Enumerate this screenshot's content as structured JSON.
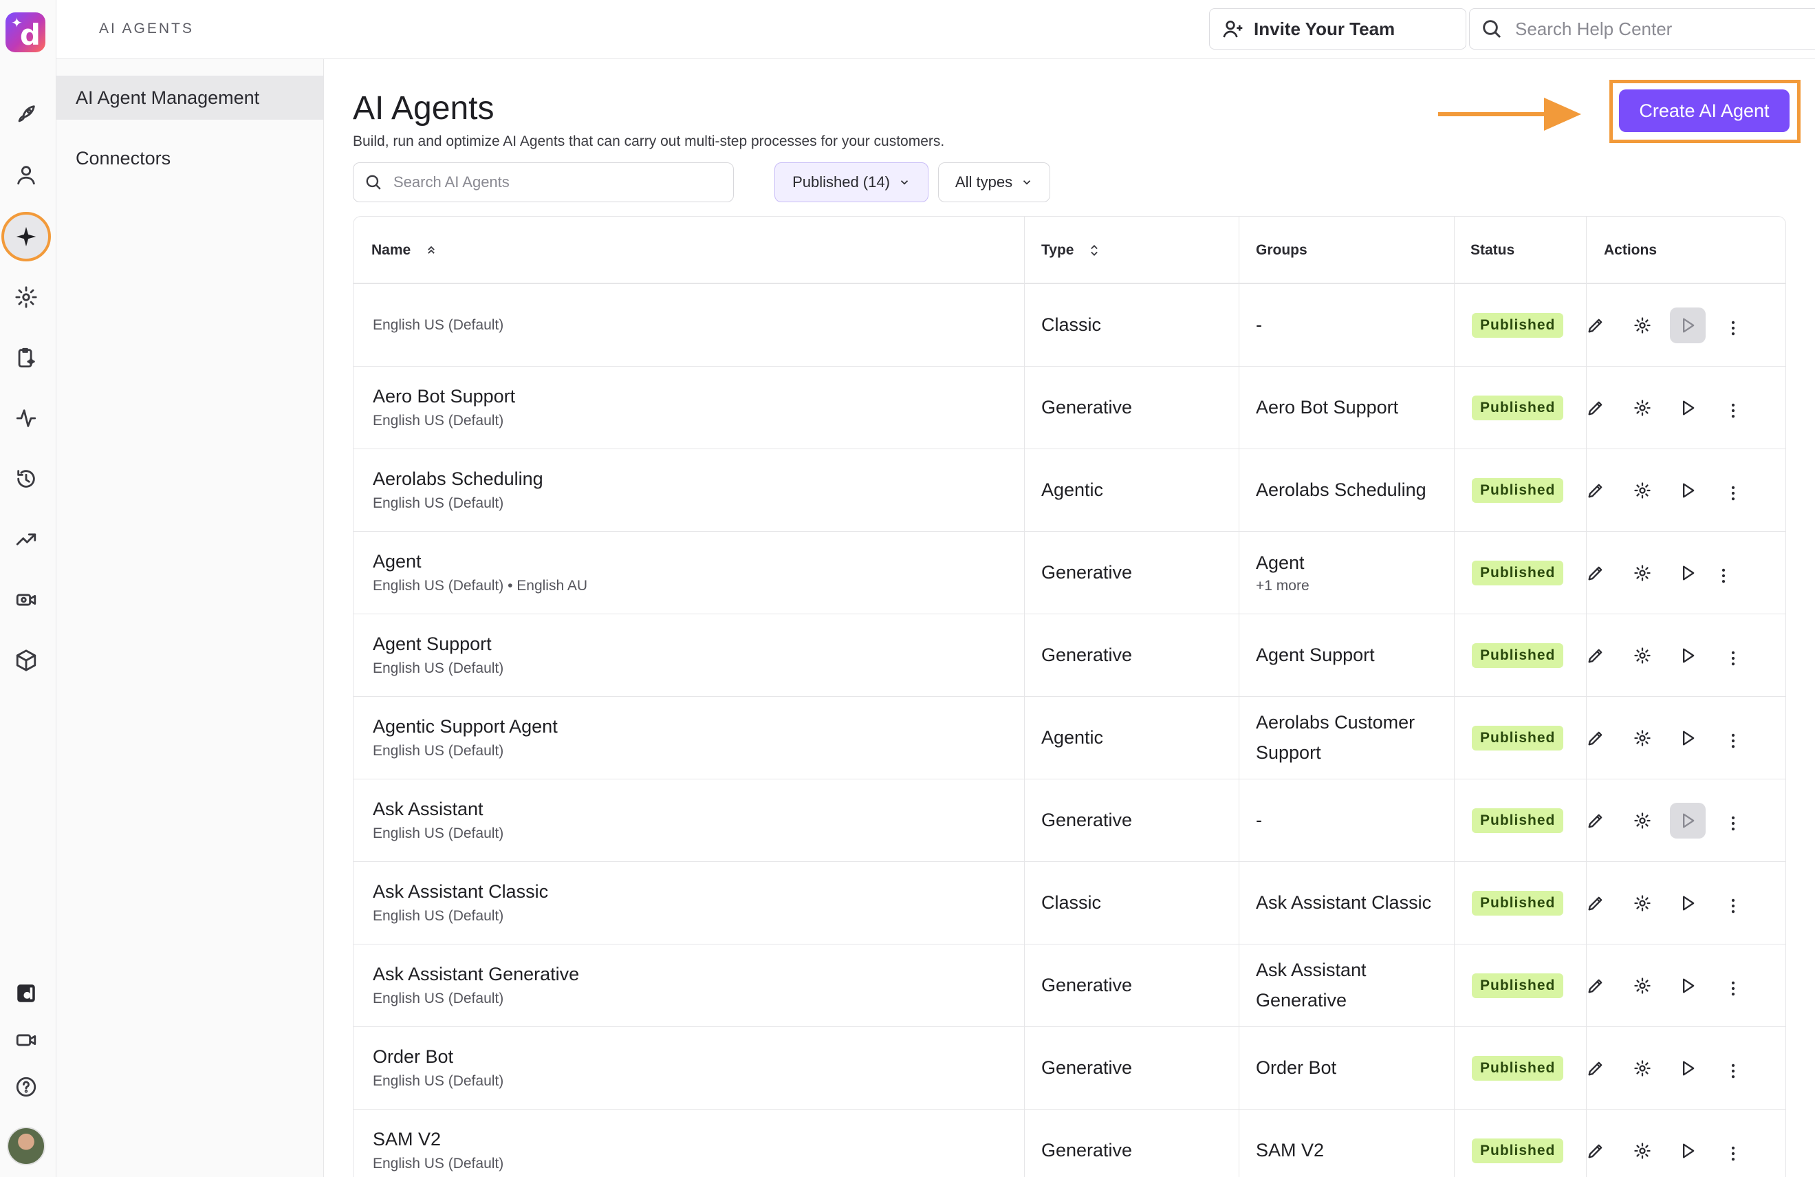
{
  "topbar": {
    "breadcrumb": "AI AGENTS",
    "invite_label": "Invite Your Team",
    "help_search_placeholder": "Search Help Center"
  },
  "subnav": {
    "items": [
      {
        "label": "AI Agent Management",
        "active": true
      },
      {
        "label": "Connectors",
        "active": false
      }
    ]
  },
  "main": {
    "title": "AI Agents",
    "subtitle": "Build, run and optimize AI Agents that can carry out multi-step processes for your customers.",
    "create_label": "Create AI Agent",
    "search_placeholder": "Search AI Agents",
    "filter_status": "Published (14)",
    "filter_type": "All types"
  },
  "table": {
    "headers": {
      "name": "Name",
      "type": "Type",
      "groups": "Groups",
      "status": "Status",
      "actions": "Actions"
    },
    "rows": [
      {
        "name": "",
        "lang": "English US (Default)",
        "type": "Classic",
        "group": "-",
        "more": "",
        "status": "Published"
      },
      {
        "name": "Aero Bot Support",
        "lang": "English US (Default)",
        "type": "Generative",
        "group": "Aero Bot Support",
        "more": "",
        "status": "Published"
      },
      {
        "name": "Aerolabs Scheduling",
        "lang": "English US (Default)",
        "type": "Agentic",
        "group": "Aerolabs Scheduling",
        "more": "",
        "status": "Published"
      },
      {
        "name": "Agent",
        "lang": "English US (Default) • English AU",
        "type": "Generative",
        "group": "Agent",
        "more": "+1 more",
        "status": "Published"
      },
      {
        "name": "Agent Support",
        "lang": "English US (Default)",
        "type": "Generative",
        "group": "Agent Support",
        "more": "",
        "status": "Published"
      },
      {
        "name": "Agentic Support Agent",
        "lang": "English US (Default)",
        "type": "Agentic",
        "group": "Aerolabs Customer Support",
        "more": "",
        "status": "Published"
      },
      {
        "name": "Ask Assistant",
        "lang": "English US (Default)",
        "type": "Generative",
        "group": "-",
        "more": "",
        "status": "Published"
      },
      {
        "name": "Ask Assistant Classic",
        "lang": "English US (Default)",
        "type": "Classic",
        "group": "Ask Assistant Classic",
        "more": "",
        "status": "Published"
      },
      {
        "name": "Ask Assistant Generative",
        "lang": "English US (Default)",
        "type": "Generative",
        "group": "Ask Assistant Generative",
        "more": "",
        "status": "Published"
      },
      {
        "name": "Order Bot",
        "lang": "English US (Default)",
        "type": "Generative",
        "group": "Order Bot",
        "more": "",
        "status": "Published"
      },
      {
        "name": "SAM V2",
        "lang": "English US (Default)",
        "type": "Generative",
        "group": "SAM V2",
        "more": "",
        "status": "Published"
      }
    ]
  },
  "colors": {
    "accent": "#7a4dfa",
    "highlight": "#f29a3a",
    "badge": "#d8f5a2"
  }
}
